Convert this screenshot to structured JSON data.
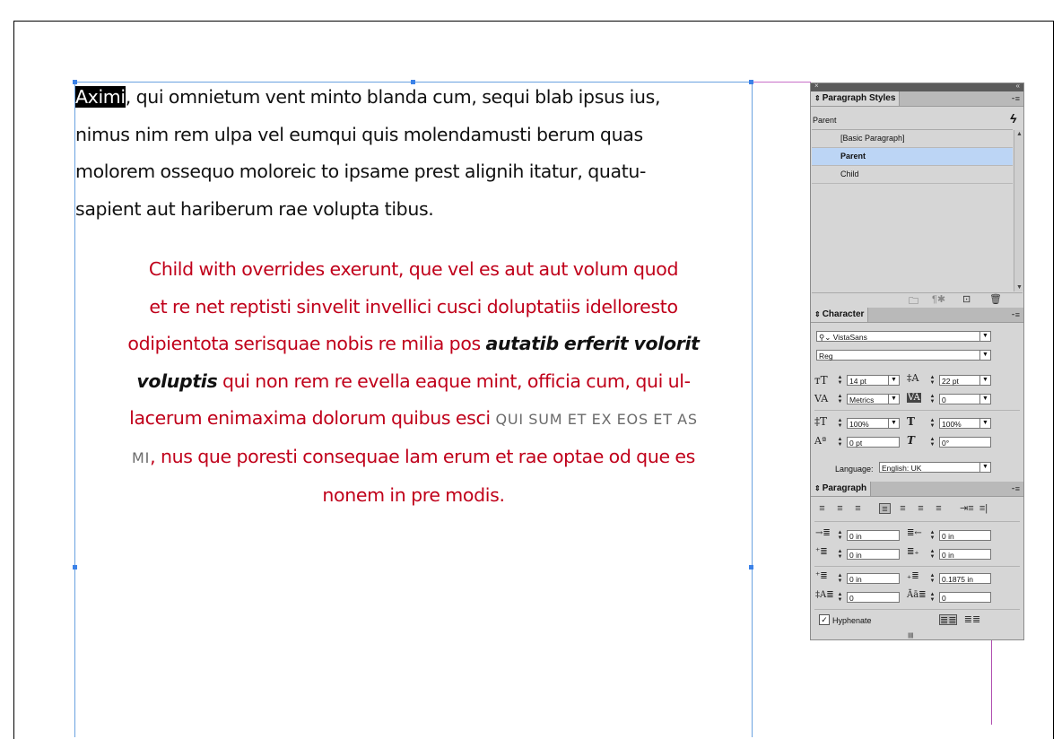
{
  "document": {
    "paragraph1_lines": [
      {
        "selected": "Aximi",
        "rest": ", qui omnietum vent minto blanda cum, sequi blab ipsus ius,"
      },
      {
        "selected": "",
        "rest": "nimus nim rem ulpa vel eumqui quis molendamusti berum quas"
      },
      {
        "selected": "",
        "rest": "molorem ossequo moloreic to ipsame prest alignih itatur, quatu-"
      },
      {
        "selected": "",
        "rest": "sapient aut hariberum rae volupta tibus."
      }
    ],
    "paragraph2": {
      "line1": "Child with overrides exerunt, que vel es aut aut volum quod",
      "line2": "et re net reptisti sinvelit invellici cusci doluptatiis idelloresto",
      "line3_a": "odipientota serisquae nobis re milia pos ",
      "line3_b": "autatib erferit volorit",
      "line4_b": "voluptis",
      "line4_a": " qui non rem re evella eaque mint, officia cum, qui ul-",
      "line5_a": "lacerum enimaxima dolorum quibus esci ",
      "line5_caps": "QUI SUM ET EX EOS ET AS",
      "line6_caps": "MI",
      "line6_a": ", nus que poresti consequae lam erum et rae optae od que es",
      "line7": "nonem in pre modis."
    }
  },
  "panel": {
    "topbar_close": "×",
    "topbar_collapse": "«",
    "paragraph_styles": {
      "tab": "Paragraph Styles",
      "current": "Parent",
      "items": [
        "[Basic Paragraph]",
        "Parent",
        "Child"
      ],
      "selected_index": 1
    },
    "character": {
      "tab": "Character",
      "font_family": "VistaSans",
      "font_style": "Reg",
      "size": "14 pt",
      "leading": "22 pt",
      "kerning": "Metrics",
      "tracking": "0",
      "vertical_scale": "100%",
      "horizontal_scale": "100%",
      "baseline_shift": "0 pt",
      "skew": "0°",
      "language_label": "Language:",
      "language": "English: UK"
    },
    "paragraph": {
      "tab": "Paragraph",
      "left_indent": "0 in",
      "right_indent": "0 in",
      "first_line_indent": "0 in",
      "last_line_indent": "0 in",
      "space_before": "0 in",
      "space_after": "0.1875 in",
      "drop_cap_lines": "0",
      "drop_cap_chars": "0",
      "hyphenate_label": "Hyphenate",
      "hyphenate_checked": true
    }
  }
}
